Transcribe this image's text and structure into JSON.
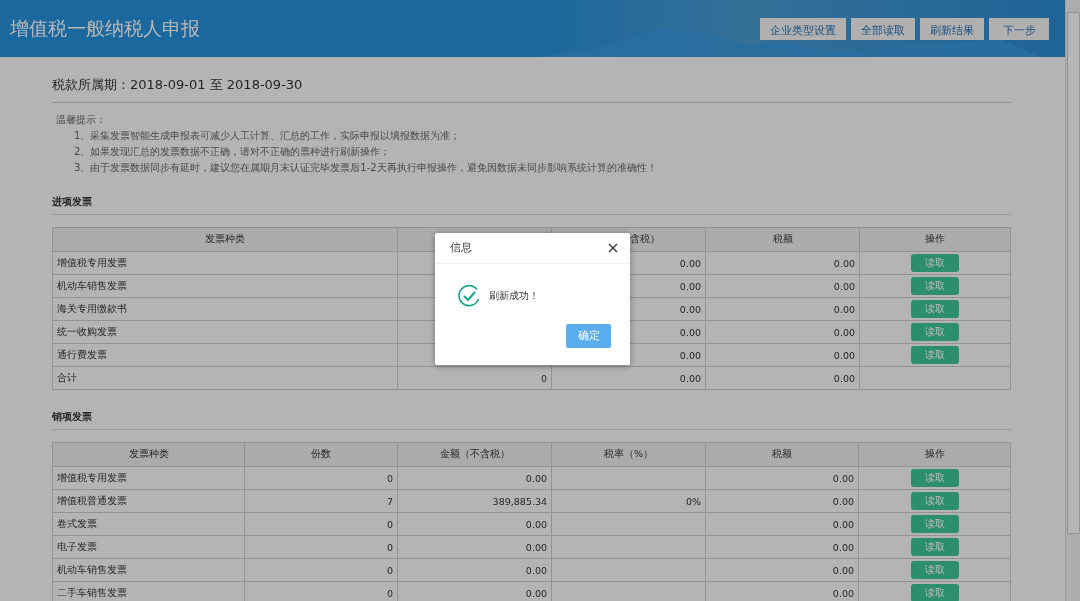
{
  "header": {
    "title": "增值税一般纳税人申报",
    "buttons": [
      "企业类型设置",
      "全部读取",
      "刷新结果",
      "下一步"
    ]
  },
  "period": "税款所属期：2018-09-01 至 2018-09-30",
  "notice": {
    "title": "温馨提示：",
    "items": [
      "1、采集发票智能生成申报表可减少人工计算、汇总的工作，实际申报以填报数据为准；",
      "2、如果发现汇总的发票数据不正确，请对不正确的票种进行刷新操作；",
      "3、由于发票数据同步有延时，建议您在属期月末认证完毕发票后1-2天再执行申报操作，避免因数据未同步影响系统计算的准确性！"
    ]
  },
  "sections": [
    {
      "kind": "purchase",
      "title": "进项发票",
      "headers": {
        "type": "发票种类",
        "amount": "含税）",
        "tax": "税额",
        "action": "操作"
      },
      "rows": [
        {
          "type": "增值税专用发票",
          "amount": "0.00",
          "tax": "0.00",
          "action": "读取"
        },
        {
          "type": "机动车销售发票",
          "amount": "0.00",
          "tax": "0.00",
          "action": "读取"
        },
        {
          "type": "海关专用缴款书",
          "amount": "0.00",
          "tax": "0.00",
          "action": "读取"
        },
        {
          "type": "统一收购发票",
          "amount": "0.00",
          "tax": "0.00",
          "action": "读取"
        },
        {
          "type": "通行费发票",
          "amount": "0.00",
          "tax": "0.00",
          "action": "读取"
        },
        {
          "type": "合计",
          "count": "0",
          "amount": "0.00",
          "tax": "0.00"
        }
      ]
    },
    {
      "kind": "sales",
      "title": "销项发票",
      "headers": {
        "type": "发票种类",
        "count": "份数",
        "amount": "金额（不含税）",
        "rate": "税率（%）",
        "tax": "税额",
        "action": "操作"
      },
      "rows": [
        {
          "type": "增值税专用发票",
          "count": "0",
          "amount": "0.00",
          "tax": "0.00",
          "action": "读取"
        },
        {
          "type": "增值税普通发票",
          "count": "7",
          "amount": "389,885.34",
          "rate": "0%",
          "tax": "0.00",
          "action": "读取"
        },
        {
          "type": "卷式发票",
          "count": "0",
          "amount": "0.00",
          "tax": "0.00",
          "action": "读取"
        },
        {
          "type": "电子发票",
          "count": "0",
          "amount": "0.00",
          "tax": "0.00",
          "action": "读取"
        },
        {
          "type": "机动车销售发票",
          "count": "0",
          "amount": "0.00",
          "tax": "0.00",
          "action": "读取"
        },
        {
          "type": "二手车销售发票",
          "count": "0",
          "amount": "0.00",
          "tax": "0.00",
          "action": "读取"
        }
      ]
    }
  ],
  "dialog": {
    "title": "信息",
    "message": "刷新成功！",
    "button": "确定"
  }
}
